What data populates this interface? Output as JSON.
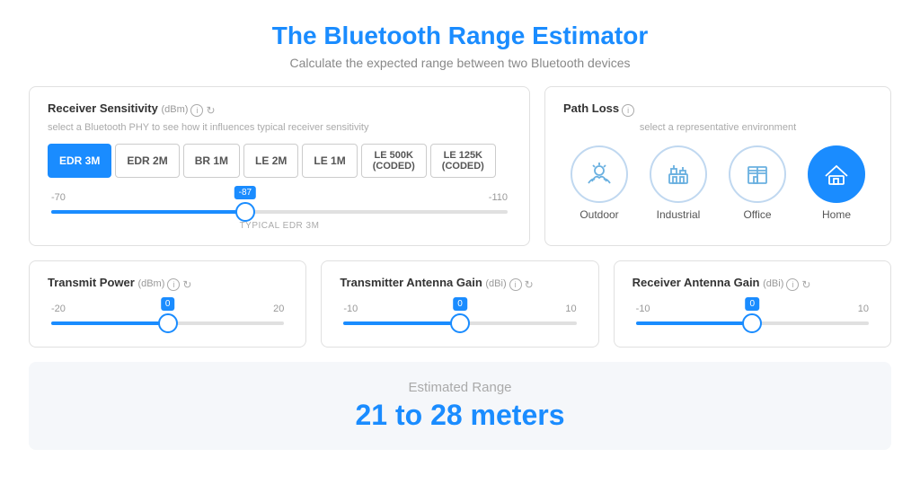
{
  "header": {
    "title": "The Bluetooth Range Estimator",
    "subtitle": "Calculate the expected range between two Bluetooth devices"
  },
  "receiver_sensitivity": {
    "label": "Receiver Sensitivity",
    "unit": "(dBm)",
    "subtitle": "select a Bluetooth PHY to see how it influences typical receiver sensitivity",
    "phy_buttons": [
      {
        "id": "edr3m",
        "label": "EDR 3M",
        "active": true
      },
      {
        "id": "edr2m",
        "label": "EDR 2M",
        "active": false
      },
      {
        "id": "br1m",
        "label": "BR 1M",
        "active": false
      },
      {
        "id": "le2m",
        "label": "LE 2M",
        "active": false
      },
      {
        "id": "le1m",
        "label": "LE 1M",
        "active": false
      },
      {
        "id": "le500k",
        "label": "LE 500K (CODED)",
        "active": false
      },
      {
        "id": "le125k",
        "label": "LE 125K (CODED)",
        "active": false
      }
    ],
    "slider": {
      "min": -70,
      "max": -110,
      "value": -87,
      "label": "TYPICAL EDR 3M",
      "fill_pct": 42.5
    }
  },
  "path_loss": {
    "label": "Path Loss",
    "subtitle": "select a representative environment",
    "environments": [
      {
        "id": "outdoor",
        "label": "Outdoor",
        "active": false
      },
      {
        "id": "industrial",
        "label": "Industrial",
        "active": false
      },
      {
        "id": "office",
        "label": "Office",
        "active": false
      },
      {
        "id": "home",
        "label": "Home",
        "active": true
      }
    ]
  },
  "transmit_power": {
    "label": "Transmit Power",
    "unit": "(dBm)",
    "slider": {
      "min": -20,
      "max": 20,
      "value": 0,
      "fill_pct": 50
    }
  },
  "tx_antenna": {
    "label": "Transmitter Antenna Gain",
    "unit": "(dBi)",
    "slider": {
      "min": -10,
      "max": 10,
      "value": 0,
      "fill_pct": 50
    }
  },
  "rx_antenna": {
    "label": "Receiver Antenna Gain",
    "unit": "(dBi)",
    "slider": {
      "min": -10,
      "max": 10,
      "value": 0,
      "fill_pct": 50
    }
  },
  "estimated_range": {
    "label": "Estimated Range",
    "value": "21 to 28 meters"
  }
}
